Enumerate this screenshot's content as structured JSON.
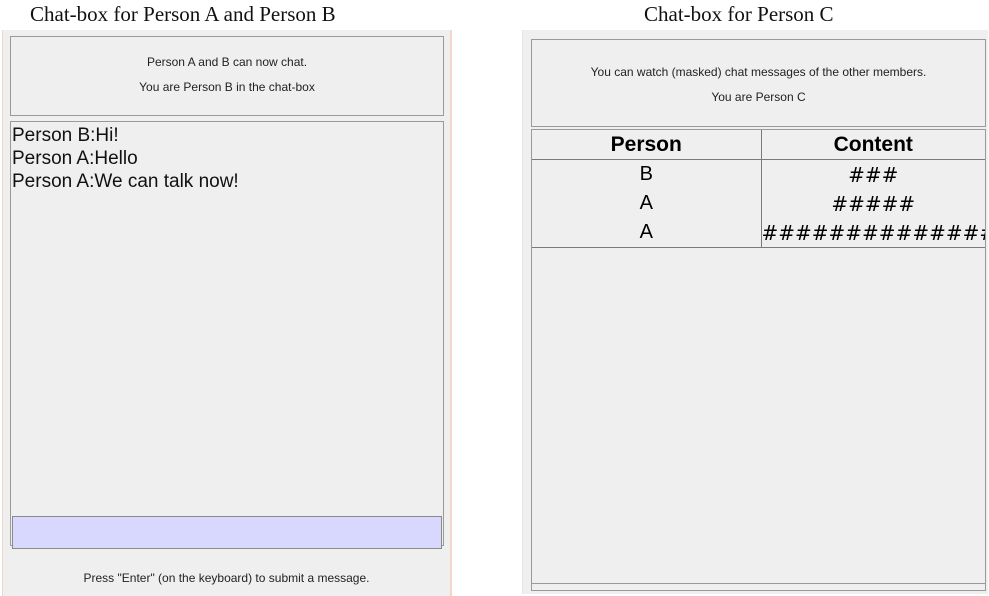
{
  "captions": {
    "left": "Chat-box for Person A and Person B",
    "right": "Chat-box for Person C"
  },
  "chat_ab": {
    "info_line1": "Person A and B can now chat.",
    "info_line2": "You are Person B in the chat-box",
    "messages": [
      "Person B:Hi!",
      "Person A:Hello",
      "Person A:We can talk now!"
    ],
    "input_value": "",
    "input_color": "#d8d8ff",
    "hint": "Press \"Enter\" (on the keyboard) to submit a message."
  },
  "chat_c": {
    "info_line1": "You can watch (masked) chat messages of the other members.",
    "info_line2": "You are Person C",
    "table": {
      "headers": [
        "Person",
        "Content"
      ],
      "rows": [
        {
          "person": "B",
          "content": "###"
        },
        {
          "person": "A",
          "content": "#####"
        },
        {
          "person": "A",
          "content": "################"
        }
      ]
    }
  }
}
